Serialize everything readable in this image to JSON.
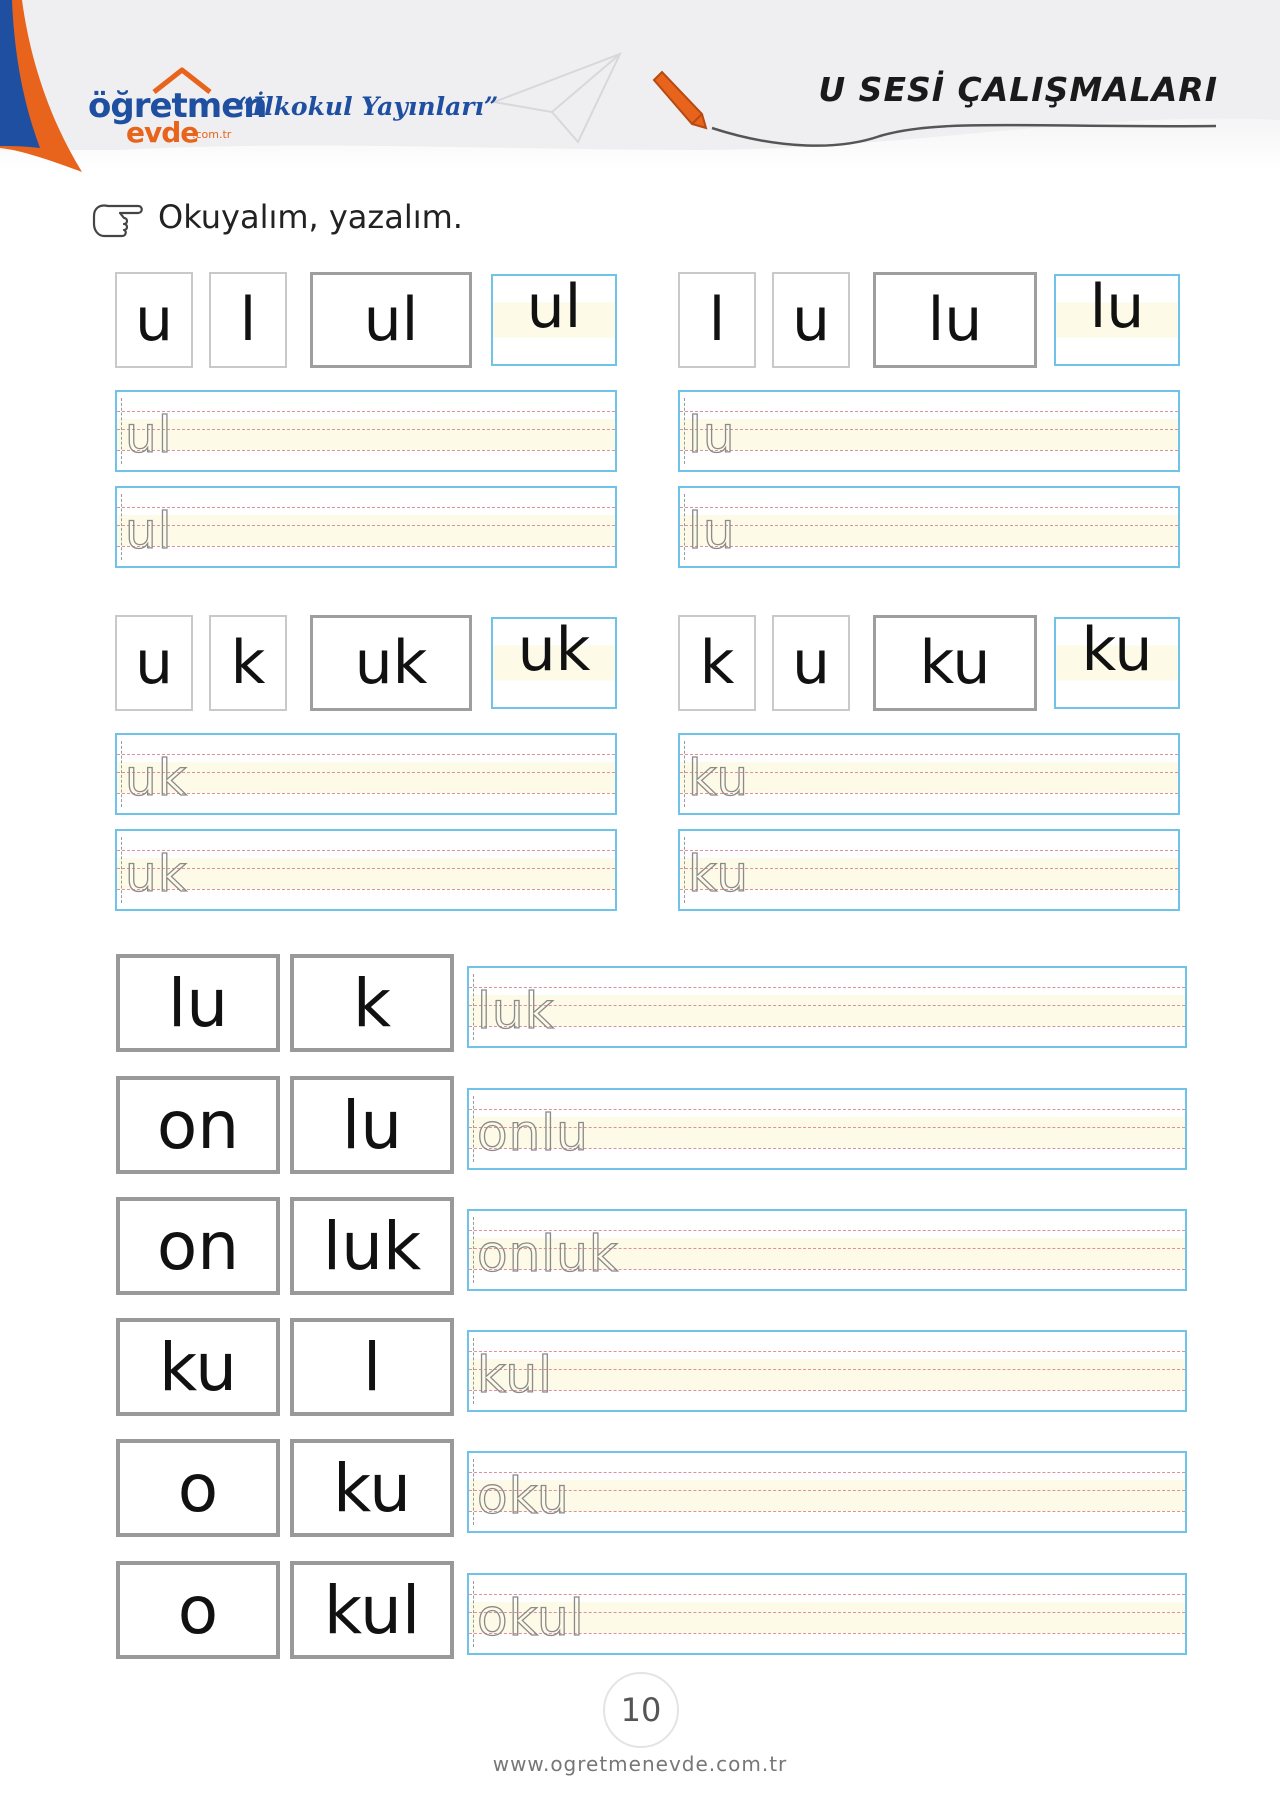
{
  "header": {
    "logo_line1": "öğretmen",
    "logo_line2": "evde",
    "logo_domain": ".com.tr",
    "series": "“İlkokul Yayınları”",
    "title": "U SESİ ÇALIŞMALARI",
    "colors": {
      "brand_blue": "#1f4fa0",
      "brand_orange": "#e8631b"
    }
  },
  "instruction": {
    "icon": "pointing-hand-icon",
    "text": "Okuyalım, yazalım."
  },
  "groups": [
    {
      "parts": [
        "u",
        "l"
      ],
      "combined": "ul",
      "model": "ul",
      "traces": [
        "ul",
        "ul"
      ]
    },
    {
      "parts": [
        "l",
        "u"
      ],
      "combined": "lu",
      "model": "lu",
      "traces": [
        "lu",
        "lu"
      ]
    },
    {
      "parts": [
        "u",
        "k"
      ],
      "combined": "uk",
      "model": "uk",
      "traces": [
        "uk",
        "uk"
      ]
    },
    {
      "parts": [
        "k",
        "u"
      ],
      "combined": "ku",
      "model": "ku",
      "traces": [
        "ku",
        "ku"
      ]
    }
  ],
  "words": [
    {
      "a": "lu",
      "b": "k",
      "trace": "luk"
    },
    {
      "a": "on",
      "b": "lu",
      "trace": "onlu"
    },
    {
      "a": "on",
      "b": "luk",
      "trace": "onluk"
    },
    {
      "a": "ku",
      "b": "l",
      "trace": "kul"
    },
    {
      "a": "o",
      "b": "ku",
      "trace": "oku"
    },
    {
      "a": "o",
      "b": "kul",
      "trace": "okul"
    }
  ],
  "footer": {
    "page_number": "10",
    "url": "www.ogretmenevde.com.tr"
  }
}
